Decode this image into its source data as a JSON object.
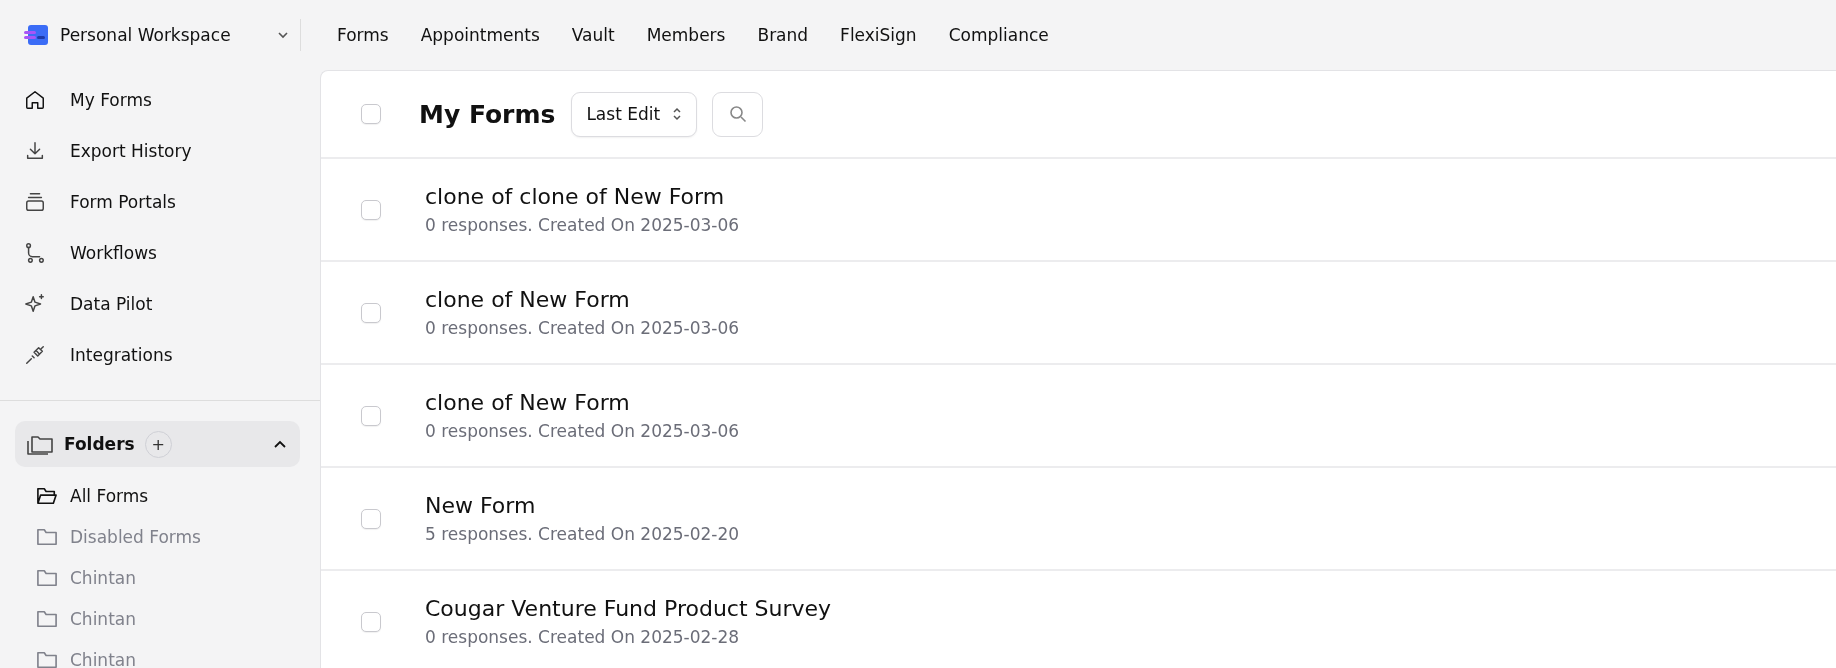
{
  "workspace": {
    "name": "Personal Workspace"
  },
  "top_nav": [
    {
      "label": "Forms"
    },
    {
      "label": "Appointments"
    },
    {
      "label": "Vault"
    },
    {
      "label": "Members"
    },
    {
      "label": "Brand"
    },
    {
      "label": "FlexiSign"
    },
    {
      "label": "Compliance"
    }
  ],
  "sidebar": {
    "items": [
      {
        "label": "My Forms",
        "kind": "home"
      },
      {
        "label": "Export History",
        "kind": "download"
      },
      {
        "label": "Form Portals",
        "kind": "portal"
      },
      {
        "label": "Workflows",
        "kind": "workflow"
      },
      {
        "label": "Data Pilot",
        "kind": "sparkle"
      },
      {
        "label": "Integrations",
        "kind": "plug"
      }
    ],
    "folders": {
      "label": "Folders",
      "add": "+",
      "expanded": true,
      "items": [
        {
          "label": "All Forms",
          "selected": true
        },
        {
          "label": "Disabled Forms",
          "selected": false
        },
        {
          "label": "Chintan",
          "selected": false
        },
        {
          "label": "Chintan",
          "selected": false
        },
        {
          "label": "Chintan",
          "selected": false
        }
      ]
    }
  },
  "main": {
    "title": "My Forms",
    "select_all": false,
    "sort": "Last Edit",
    "forms": [
      {
        "title": "clone of clone of New Form",
        "meta": "0 responses. Created On 2025-03-06",
        "checked": false
      },
      {
        "title": "clone of New Form",
        "meta": "0 responses. Created On 2025-03-06",
        "checked": false
      },
      {
        "title": "clone of New Form",
        "meta": "0 responses. Created On 2025-03-06",
        "checked": false
      },
      {
        "title": "New Form",
        "meta": "5 responses. Created On 2025-02-20",
        "checked": false
      },
      {
        "title": "Cougar Venture Fund Product Survey",
        "meta": "0 responses. Created On 2025-02-28",
        "checked": false
      }
    ]
  }
}
